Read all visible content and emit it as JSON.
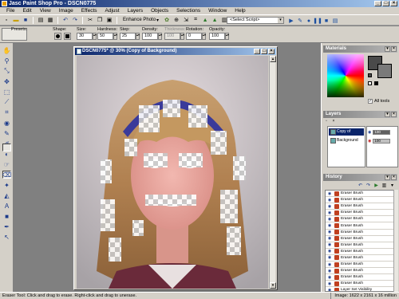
{
  "app": {
    "title": "Jasc Paint Shop Pro - DSCN0775"
  },
  "menubar": {
    "items": [
      "File",
      "Edit",
      "View",
      "Image",
      "Effects",
      "Adjust",
      "Layers",
      "Objects",
      "Selections",
      "Window",
      "Help"
    ]
  },
  "toolbar": {
    "enhance_label": "Enhance Photo",
    "script_select": "<Select Script>"
  },
  "tool_options": {
    "presets_label": "Presets:",
    "shape_label": "Shape:",
    "size_label": "Size:",
    "size_value": "30",
    "hardness_label": "Hardness:",
    "hardness_value": "50",
    "step_label": "Step:",
    "step_value": "25",
    "density_label": "Density:",
    "density_value": "100",
    "thickness_label": "Thickness:",
    "thickness_value": "100",
    "rotation_label": "Rotation:",
    "rotation_value": "0",
    "opacity_label": "Opacity:",
    "opacity_value": "100"
  },
  "image_window": {
    "title": "DSCN0775* @ 30% (Copy of Background)"
  },
  "palettes": {
    "materials_title": "Materials",
    "all_tools_label": "All tools",
    "layers_title": "Layers",
    "layers": [
      {
        "name": "Copy of Backgr",
        "opacity": "100"
      },
      {
        "name": "Background",
        "opacity": "100"
      }
    ],
    "history_title": "History",
    "history_items": [
      "Eraser Brush",
      "Eraser Brush",
      "Eraser Brush",
      "Eraser Brush",
      "Eraser Brush",
      "Eraser Brush",
      "Eraser Brush",
      "Eraser Brush",
      "Eraser Brush",
      "Eraser Brush",
      "Eraser Brush",
      "Eraser Brush",
      "Eraser Brush",
      "Eraser Brush",
      "Eraser Brush",
      "Layer Set Visibility"
    ]
  },
  "status": {
    "left": "Eraser Tool: Click and drag to erase. Right-click and drag to unerase.",
    "right": "Image: 1622 x 2161 x 16 million"
  },
  "colors": {
    "title_gradient_start": "#0a246a",
    "title_gradient_end": "#a6caf0",
    "chrome": "#d4d0c8",
    "workspace": "#808080",
    "foreground": "#4a4a4a",
    "background": "#7a7a7a"
  }
}
